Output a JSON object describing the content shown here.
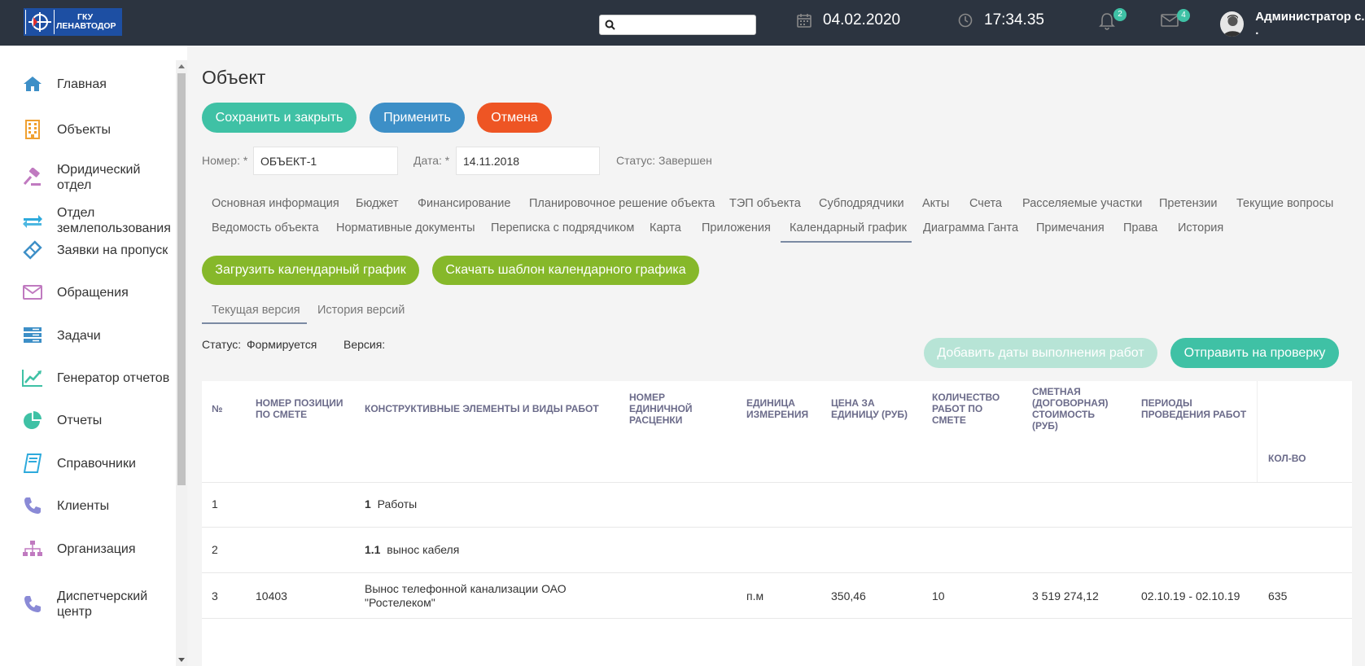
{
  "header": {
    "logo_line1": "ГКУ",
    "logo_line2": "ЛЕНАВТОДОР",
    "search_placeholder": "",
    "date": "04.02.2020",
    "time": "17:34.35",
    "notifications_count": "2",
    "messages_count": "4",
    "user_name": "Администратор с. ."
  },
  "sidebar": {
    "items": [
      {
        "label": "Главная",
        "icon": "home-icon",
        "color": "#3d8fc7"
      },
      {
        "label": "Объекты",
        "icon": "building-icon",
        "color": "#f0a030"
      },
      {
        "label": "Юридический отдел",
        "icon": "gavel-icon",
        "color": "#c07ac0"
      },
      {
        "label": "Отдел землепользования",
        "icon": "exchange-icon",
        "color": "#2eaadc"
      },
      {
        "label": "Заявки на пропуск",
        "icon": "ticket-icon",
        "color": "#3d8fc7"
      },
      {
        "label": "Обращения",
        "icon": "envelope-icon",
        "color": "#c07ac0"
      },
      {
        "label": "Задачи",
        "icon": "tasks-icon",
        "color": "#3d8fc7"
      },
      {
        "label": "Генератор отчетов",
        "icon": "chart-line-icon",
        "color": "#3fc1a5"
      },
      {
        "label": "Отчеты",
        "icon": "pie-chart-icon",
        "color": "#3fc1a5"
      },
      {
        "label": "Справочники",
        "icon": "book-icon",
        "color": "#2eaadc"
      },
      {
        "label": "Клиенты",
        "icon": "phone-icon",
        "color": "#8a8ad6"
      },
      {
        "label": "Организация",
        "icon": "sitemap-icon",
        "color": "#c07ac0"
      },
      {
        "label": "Диспетчерский центр",
        "icon": "phone-icon",
        "color": "#8a8ad6"
      }
    ]
  },
  "main": {
    "title": "Объект",
    "buttons": {
      "save_close": "Сохранить и закрыть",
      "apply": "Применить",
      "cancel": "Отмена"
    },
    "fields": {
      "number_label": "Номер:",
      "number_value": "ОБЪЕКТ-1",
      "date_label": "Дата:",
      "date_value": "14.11.2018",
      "required_mark": "*",
      "status": "Статус: Завершен"
    },
    "tabs": [
      "Основная информация",
      "Бюджет",
      "Финансирование",
      "Планировочное решение объекта",
      "ТЭП объекта",
      "Субподрядчики",
      "Акты",
      "Счета",
      "Расселяемые участки",
      "Претензии",
      "Текущие вопросы",
      "Ведомость объекта",
      "Нормативные документы",
      "Переписка с подрядчиком",
      "Карта",
      "Приложения",
      "Календарный график",
      "Диаграмма Ганта",
      "Примечания",
      "Права",
      "История"
    ],
    "active_tab": "Календарный график",
    "schedule_buttons": {
      "upload": "Загрузить календарный график",
      "download_template": "Скачать шаблон календарного графика"
    },
    "version_tabs": [
      "Текущая версия",
      "История версий"
    ],
    "version_status_label": "Статус:",
    "version_status_value": "Формируется",
    "version_label": "Версия:",
    "add_dates_button": "Добавить даты выполнения работ",
    "send_review_button": "Отправить на проверку"
  },
  "table": {
    "columns": [
      "№",
      "Номер позиции по смете",
      "Конструктивные элементы и виды работ",
      "Номер единичной расценки",
      "Единица измерения",
      "Цена за единицу (руб)",
      "Количество работ по смете",
      "Сметная (договорная) стоимость (руб)",
      "Периоды проведения работ",
      "Кол-во"
    ],
    "rows": [
      {
        "n": "1",
        "pos": "",
        "code": "1",
        "name": "Работы",
        "rate": "",
        "unit": "",
        "price": "",
        "qty": "",
        "cost": "",
        "period": "",
        "count": ""
      },
      {
        "n": "2",
        "pos": "",
        "code": "1.1",
        "name": "вынос кабеля",
        "rate": "",
        "unit": "",
        "price": "",
        "qty": "",
        "cost": "",
        "period": "",
        "count": ""
      },
      {
        "n": "3",
        "pos": "10403",
        "code": "",
        "name": "Вынос телефонной канализации ОАО \"Ростелеком\"",
        "rate": "",
        "unit": "п.м",
        "price": "350,46",
        "qty": "10",
        "cost": "3 519 274,12",
        "period": "02.10.19 - 02.10.19",
        "count": "635"
      }
    ]
  }
}
